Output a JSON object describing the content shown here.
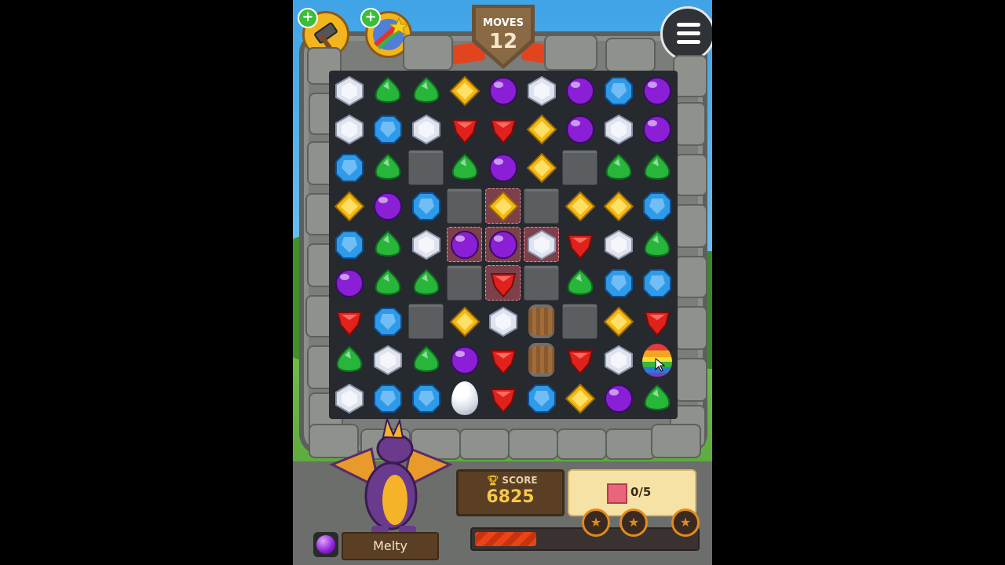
{
  "hud": {
    "moves_label": "MOVES",
    "moves_value": "12",
    "plus_symbol": "+",
    "menu_icon": "hamburger-menu-icon",
    "booster_icons": [
      "hammer-booster-icon",
      "shooting-star-booster-icon"
    ]
  },
  "score": {
    "label": "SCORE",
    "value": "6825",
    "icon": "trophy-icon"
  },
  "goal": {
    "icon": "red-tile-icon",
    "text": "0/5",
    "star_icon": "★",
    "progress_fraction": 0.28
  },
  "dragon": {
    "name": "Melty",
    "orb_icon": "purple-orb-icon"
  },
  "colors": {
    "red": "#e0211c",
    "green": "#27b53a",
    "purple": "#8a1fd6",
    "yellow": "#f5b711",
    "blue": "#2f9be8",
    "white": "#dfe3ee"
  },
  "board": {
    "rows": [
      [
        "white",
        "green",
        "green",
        "yellow",
        "purple",
        "white",
        "purple",
        "blue",
        "purple"
      ],
      [
        "white",
        "blue",
        "white",
        "red",
        "red",
        "yellow",
        "purple",
        "white",
        "purple"
      ],
      [
        "blue",
        "green",
        "block",
        "green",
        "purple",
        "yellow",
        "block",
        "green",
        "green"
      ],
      [
        "yellow",
        "purple",
        "blue",
        "block",
        "yellow",
        "block",
        "yellow",
        "yellow",
        "blue"
      ],
      [
        "blue",
        "green",
        "white",
        "purple",
        "purple",
        "white",
        "red",
        "white",
        "green"
      ],
      [
        "purple",
        "green",
        "green",
        "block",
        "red",
        "block",
        "green",
        "blue",
        "blue"
      ],
      [
        "red",
        "blue",
        "block",
        "yellow",
        "white",
        "barrel",
        "block",
        "yellow",
        "red"
      ],
      [
        "green",
        "white",
        "green",
        "purple",
        "red",
        "barrel",
        "red",
        "white",
        "rainbow"
      ],
      [
        "white",
        "blue",
        "blue",
        "egg",
        "red",
        "blue",
        "yellow",
        "purple",
        "green"
      ]
    ],
    "tiles": [
      [
        3,
        4
      ],
      [
        4,
        3
      ],
      [
        4,
        4
      ],
      [
        4,
        5
      ],
      [
        5,
        4
      ]
    ]
  }
}
